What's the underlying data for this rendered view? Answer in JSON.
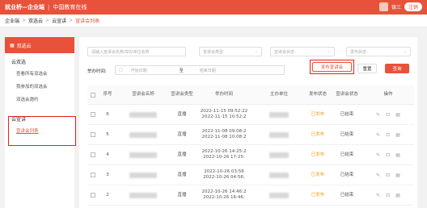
{
  "header": {
    "brand": "就业桥—企业端",
    "separator": "|",
    "subtitle": "中国教育在线",
    "user_name": "银三",
    "logout_label": "注销"
  },
  "breadcrumb": {
    "items": [
      "企业端",
      "双选云",
      "云宣讲",
      "宣讲会列表"
    ],
    "separator": ">"
  },
  "sidebar": {
    "title": "双选云",
    "groups": [
      {
        "label": "云双选",
        "items": [
          "查看所有双选会",
          "我参加的双选会",
          "双选会邀约"
        ]
      },
      {
        "label": "云宣讲",
        "items": [
          "宣讲会列表"
        ]
      }
    ]
  },
  "filters": {
    "name_placeholder": "请输入宣讲会名称/举办单位名称",
    "type_placeholder": "宣讲会类型",
    "status_placeholder": "宣讲会状态",
    "publish_placeholder": "发布状态",
    "time_label": "举办时间:",
    "start_placeholder": "开始日期",
    "to_label": "至",
    "end_placeholder": "结束日期",
    "publish_button": "发布宣讲会",
    "reset_button": "重置",
    "search_button": "查询"
  },
  "table": {
    "columns": [
      "序号",
      "宣讲会名称",
      "宣讲会类型",
      "举办时间",
      "主办单位",
      "发布状态",
      "宣讲会状态",
      "操作"
    ],
    "rows": [
      {
        "index": "6",
        "type": "直播",
        "time": "2022-11-15 09:52:22\n2022-11-15 10:52:2",
        "publish": "已发布",
        "status": "已结束"
      },
      {
        "index": "5",
        "type": "直播",
        "time": "2022-11-08 09:08:2\n2022-11-08 10:08:2",
        "publish": "已发布",
        "status": "已结束"
      },
      {
        "index": "4",
        "type": "直播",
        "time": "2022-10-26 14:25:2\n2022-10-26 17:25:",
        "publish": "已发布",
        "status": "已结束"
      },
      {
        "index": "3",
        "type": "直播",
        "time": "2022-10-26 03:56\n2022-10-26 04:56:",
        "publish": "已发布",
        "status": "已结束"
      },
      {
        "index": "2",
        "type": "直播",
        "time": "2022-10-26 14:46:2\n2022-10-26 16:46:",
        "publish": "已发布",
        "status": "已结束"
      }
    ],
    "op_icons": [
      "edit-icon",
      "view-icon",
      "delete-icon"
    ]
  }
}
